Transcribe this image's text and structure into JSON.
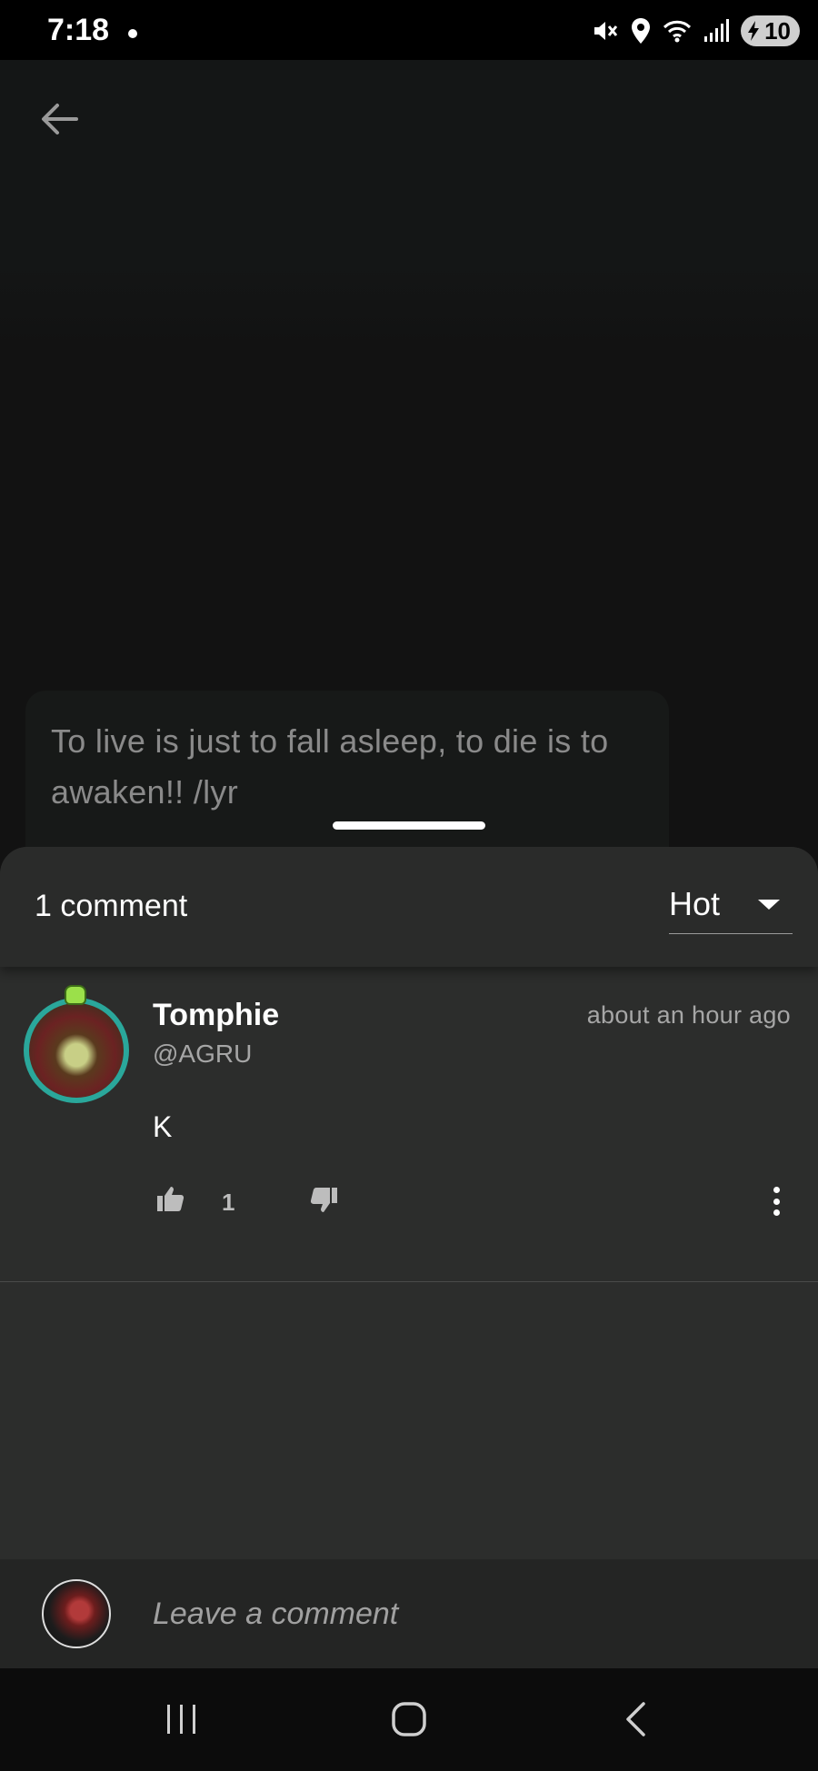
{
  "status_bar": {
    "time": "7:18",
    "battery_level": "10",
    "icons": [
      "dot-icon",
      "mute-icon",
      "location-icon",
      "wifi-icon",
      "signal-icon",
      "battery-charging-icon"
    ]
  },
  "post": {
    "back_icon": "arrow-left-icon",
    "quote": "To live is just to fall asleep, to die is to awaken!! /lyr"
  },
  "comments_sheet": {
    "count_label": "1 comment",
    "sort": {
      "selected": "Hot"
    },
    "comments": [
      {
        "author_name": "Tomphie",
        "author_handle": "@AGRU",
        "time": "about an hour ago",
        "text": "K",
        "likes": "1"
      }
    ]
  },
  "composer": {
    "placeholder": "Leave a comment"
  },
  "colors": {
    "sheet_bg": "#2c2d2c",
    "avatar_ring": "#2aa79b",
    "muted_text": "#a6a6a6"
  }
}
